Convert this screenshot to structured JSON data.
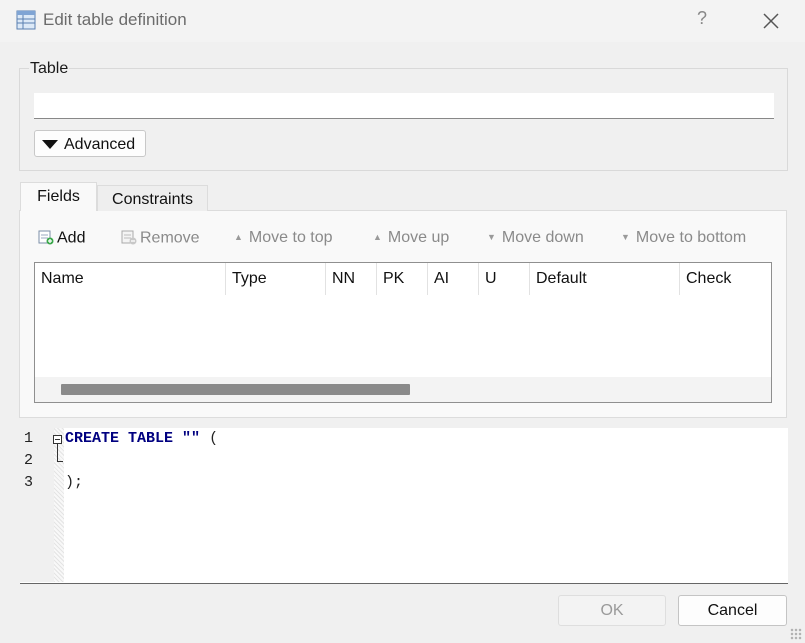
{
  "window": {
    "title": "Edit table definition",
    "help_glyph": "?",
    "icon": "table-icon",
    "close_icon": "close-icon"
  },
  "table_group": {
    "label": "Table",
    "name_value": "",
    "advanced_label": "Advanced"
  },
  "tabs": [
    {
      "label": "Fields",
      "selected": true
    },
    {
      "label": "Constraints",
      "selected": false
    }
  ],
  "toolbar": {
    "add": "Add",
    "remove": "Remove",
    "move_to_top": "Move to top",
    "move_up": "Move up",
    "move_down": "Move down",
    "move_to_bottom": "Move to bottom"
  },
  "fields_grid": {
    "columns": [
      "Name",
      "Type",
      "NN",
      "PK",
      "AI",
      "U",
      "Default",
      "Check"
    ],
    "rows": []
  },
  "sql_editor": {
    "line_numbers": [
      "1",
      "2",
      "3"
    ],
    "line1_keywords": "CREATE TABLE",
    "line1_string": "\"\"",
    "line1_paren": "(",
    "line3": ");"
  },
  "buttons": {
    "ok": "OK",
    "cancel": "Cancel"
  },
  "colors": {
    "sql_keyword": "#000080",
    "disabled_text": "#8a8a8a"
  }
}
